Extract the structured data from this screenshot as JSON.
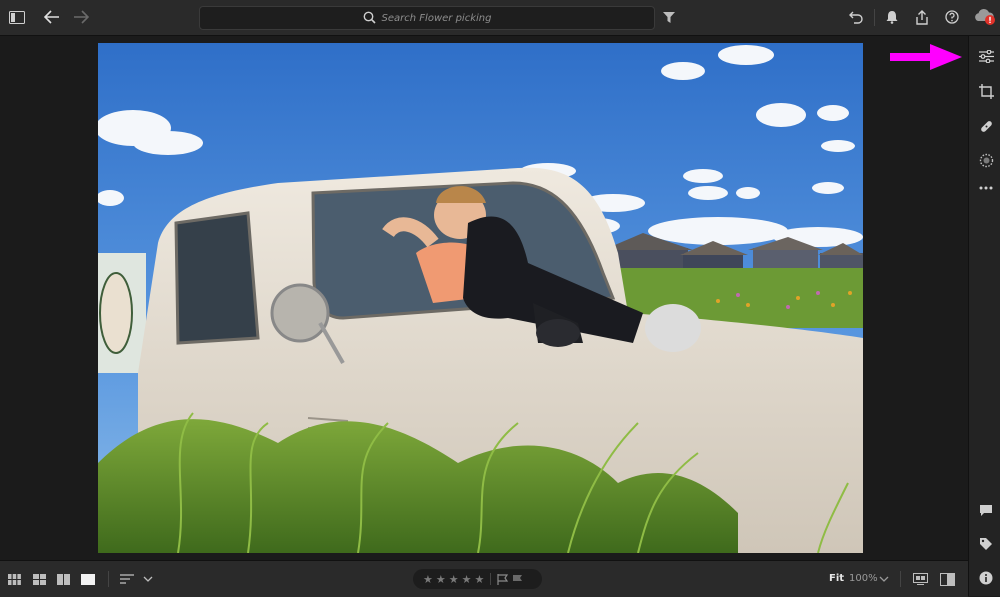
{
  "search": {
    "placeholder": "Search Flower picking"
  },
  "bottom": {
    "fit_label": "Fit",
    "zoom_label": "100%"
  },
  "rating": {
    "stars": 0,
    "max_stars": 5
  },
  "colors": {
    "accent_arrow": "#ff00ff",
    "badge": "#e0322a"
  },
  "icons": {
    "top": [
      "sidebar-toggle-icon",
      "back-arrow-icon",
      "forward-arrow-icon",
      "search-icon",
      "filter-icon",
      "undo-icon",
      "bell-icon",
      "share-icon",
      "help-icon",
      "cloud-icon"
    ],
    "right": [
      "edit-sliders-icon",
      "crop-icon",
      "healing-icon",
      "masking-icon",
      "more-icon",
      "comment-icon",
      "tag-icon",
      "info-icon"
    ],
    "bottom": [
      "grid-view-icon",
      "square-grid-icon",
      "compare-icon",
      "detail-view-icon",
      "sort-icon",
      "chevron-down-icon",
      "flag-icon",
      "zoom-chevron-icon",
      "presets-icon",
      "before-after-icon"
    ]
  }
}
